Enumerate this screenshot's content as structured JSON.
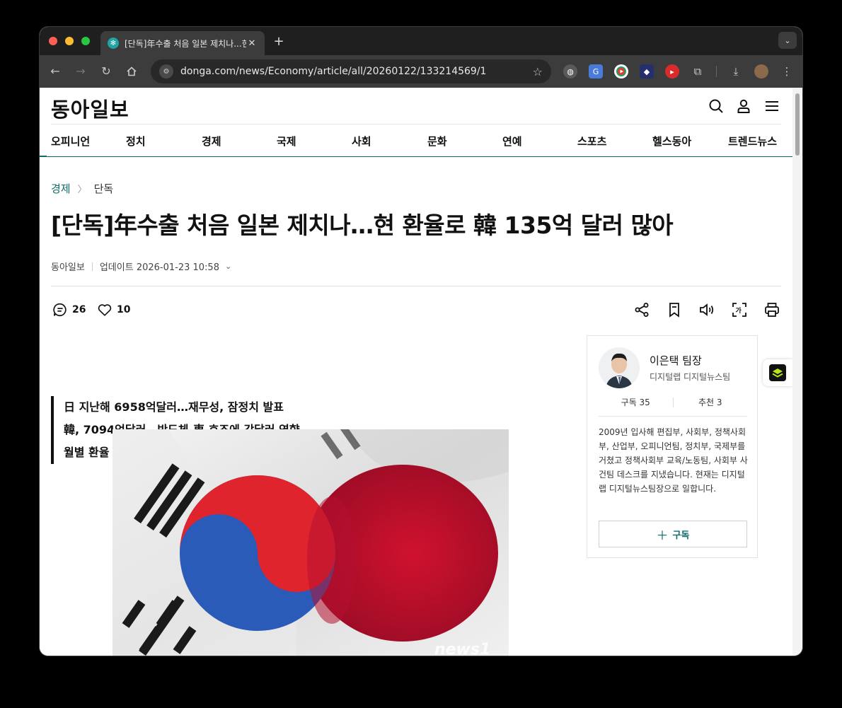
{
  "browser": {
    "tab_title": "[단독]年수출 처음 일본 제치나...현",
    "tab_close": "✕",
    "new_tab": "+",
    "url": "donga.com/news/Economy/article/all/20260122/133214569/1"
  },
  "site": {
    "logo": "동아일보",
    "nav": [
      "오피니언",
      "정치",
      "경제",
      "국제",
      "사회",
      "문화",
      "연예",
      "스포츠",
      "헬스동아",
      "트렌드뉴스"
    ]
  },
  "article": {
    "breadcrumb_section": "경제",
    "breadcrumb_sub": "단독",
    "headline": "[단독]年수출 처음 일본 제치나…현 환율로 韓 135억 달러 많아",
    "source": "동아일보",
    "updated": "업데이트 2026-01-23 10:58",
    "comment_count": "26",
    "like_count": "10",
    "summary": [
      "日 지난해 6958억달러…재무성, 잠정치 발표",
      "韓, 7094억달러…반도체-車 호조에 강달러 영향",
      "월별 환율 변동폭-WTO 발표 등 변수 남아"
    ]
  },
  "author": {
    "name": "이은택 팀장",
    "team": "디지털랩 디지털뉴스팀",
    "subscribers": "구독 35",
    "recommends": "추천 3",
    "bio": "2009년 입사해 편집부, 사회부, 정책사회부, 산업부, 오피니언팀, 정치부, 국제부를 거쳤고 정책사회부 교육/노동팀, 사회부 사건팀 데스크를 지냈습니다. 현재는 디지털랩 디지털뉴스팀장으로 일합니다.",
    "subscribe_label": "구독"
  },
  "colors": {
    "accent": "#0e6b6b",
    "korea_red": "#e0242e",
    "korea_blue": "#2a5bb8",
    "japan_red": "#c8102e"
  }
}
